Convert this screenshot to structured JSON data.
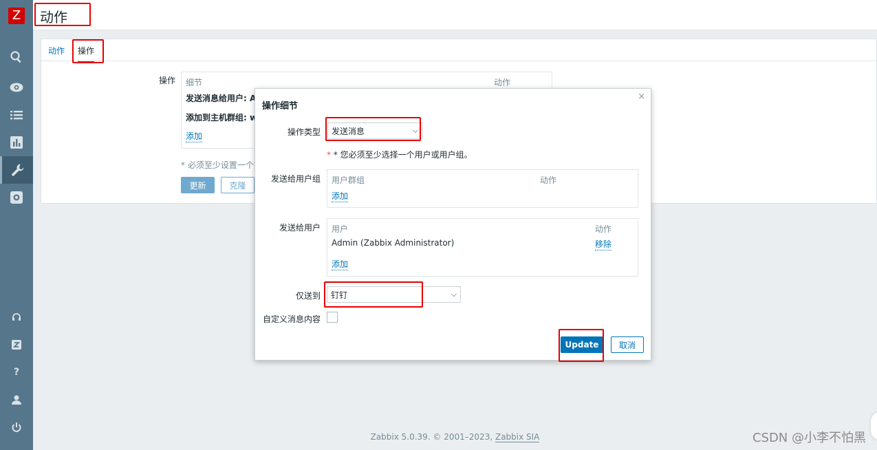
{
  "header": {
    "title": "动作"
  },
  "sidebar": {
    "logo": "Z",
    "icons": [
      "search-icon",
      "eye-icon",
      "list-icon",
      "chart-icon",
      "wrench-icon",
      "gear-icon",
      "headset-icon",
      "zabbix-share-icon",
      "help-icon",
      "user-icon",
      "power-icon"
    ]
  },
  "tabs": [
    {
      "label": "动作"
    },
    {
      "label": "操作"
    }
  ],
  "operations": {
    "label": "操作",
    "col_details": "细节",
    "col_action": "动作",
    "row1": "发送消息给用户: A",
    "row2": "添加到主机群组: w",
    "add_link": "添加",
    "required_note": "* 必须至少设置一个操",
    "update_button": "更新",
    "clone_button": "克隆"
  },
  "dialog": {
    "title": "操作细节",
    "close": "×",
    "op_type_label": "操作类型",
    "op_type_value": "发送消息",
    "required_note": "* 您必须至少选择一个用户或用户组。",
    "send_group_label": "发送给用户组",
    "group_col1": "用户群组",
    "group_col2": "动作",
    "group_add": "添加",
    "send_user_label": "发送给用户",
    "user_col1": "用户",
    "user_col2": "动作",
    "user_row": "Admin (Zabbix Administrator)",
    "user_remove": "移除",
    "user_add": "添加",
    "send_only_label": "仅送到",
    "send_only_value": "钉钉",
    "custom_msg_label": "自定义消息内容",
    "update_button": "Update",
    "cancel_button": "取消"
  },
  "footer": {
    "text": "Zabbix 5.0.39. © 2001–2023,",
    "link": "Zabbix SIA"
  },
  "watermark": "CSDN @小李不怕黑",
  "colors": {
    "sidebar": "#56768b",
    "accent": "#0275b8",
    "highlight_box": "#e60000"
  }
}
